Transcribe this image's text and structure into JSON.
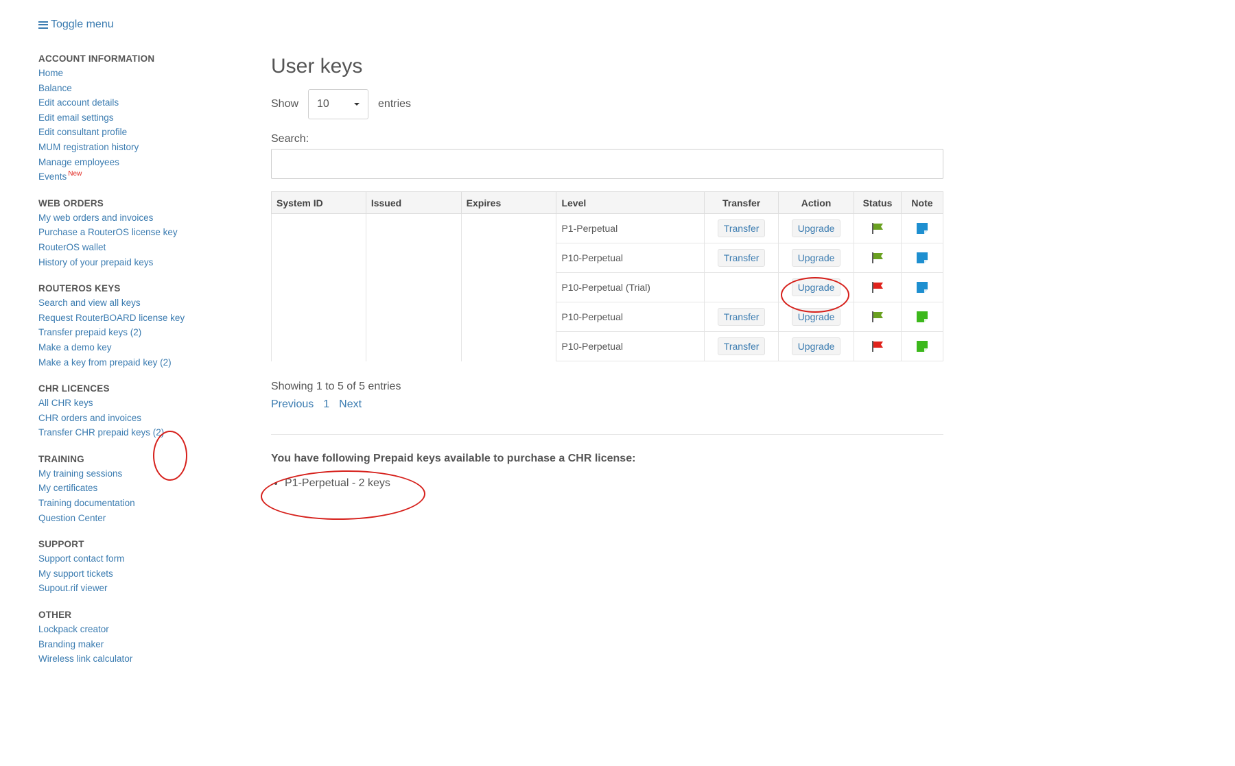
{
  "toggle_menu": "Toggle menu",
  "sidebar": {
    "sections": [
      {
        "title": "ACCOUNT INFORMATION",
        "items": [
          {
            "label": "Home"
          },
          {
            "label": "Balance"
          },
          {
            "label": "Edit account details"
          },
          {
            "label": "Edit email settings"
          },
          {
            "label": "Edit consultant profile"
          },
          {
            "label": "MUM registration history"
          },
          {
            "label": "Manage employees"
          },
          {
            "label": "Events",
            "badge": "New"
          }
        ]
      },
      {
        "title": "WEB ORDERS",
        "items": [
          {
            "label": "My web orders and invoices"
          },
          {
            "label": "Purchase a RouterOS license key"
          },
          {
            "label": "RouterOS wallet"
          },
          {
            "label": "History of your prepaid keys"
          }
        ]
      },
      {
        "title": "ROUTEROS KEYS",
        "items": [
          {
            "label": "Search and view all keys"
          },
          {
            "label": "Request RouterBOARD license key"
          },
          {
            "label": "Transfer prepaid keys (2)"
          },
          {
            "label": "Make a demo key"
          },
          {
            "label": "Make a key from prepaid key (2)"
          }
        ]
      },
      {
        "title": "CHR LICENCES",
        "items": [
          {
            "label": "All CHR keys"
          },
          {
            "label": "CHR orders and invoices"
          },
          {
            "label": "Transfer CHR prepaid keys (2)"
          }
        ]
      },
      {
        "title": "TRAINING",
        "items": [
          {
            "label": "My training sessions"
          },
          {
            "label": "My certificates"
          },
          {
            "label": "Training documentation"
          },
          {
            "label": "Question Center"
          }
        ]
      },
      {
        "title": "SUPPORT",
        "items": [
          {
            "label": "Support contact form"
          },
          {
            "label": "My support tickets"
          },
          {
            "label": "Supout.rif viewer"
          }
        ]
      },
      {
        "title": "OTHER",
        "items": [
          {
            "label": "Lockpack creator"
          },
          {
            "label": "Branding maker"
          },
          {
            "label": "Wireless link calculator"
          }
        ]
      }
    ]
  },
  "main": {
    "title": "User keys",
    "show_label": "Show",
    "entries_value": "10",
    "entries_label": "entries",
    "search_label": "Search:",
    "columns": [
      "System ID",
      "Issued",
      "Expires",
      "Level",
      "Transfer",
      "Action",
      "Status",
      "Note"
    ],
    "rows": [
      {
        "level": "P1-Perpetual",
        "transfer": "Transfer",
        "action": "Upgrade",
        "status": "ok",
        "note": "blue"
      },
      {
        "level": "P10-Perpetual",
        "transfer": "Transfer",
        "action": "Upgrade",
        "status": "ok",
        "note": "blue"
      },
      {
        "level": "P10-Perpetual (Trial)",
        "transfer": "",
        "action": "Upgrade",
        "status": "expired",
        "note": "blue"
      },
      {
        "level": "P10-Perpetual",
        "transfer": "Transfer",
        "action": "Upgrade",
        "status": "ok",
        "note": "green"
      },
      {
        "level": "P10-Perpetual",
        "transfer": "Transfer",
        "action": "Upgrade",
        "status": "expired",
        "note": "green"
      }
    ],
    "info": "Showing 1 to 5 of 5 entries",
    "pager": {
      "previous": "Previous",
      "page": "1",
      "next": "Next"
    },
    "prepaid_heading": "You have following Prepaid keys available to purchase a CHR license:",
    "prepaid_items": [
      "P1-Perpetual - 2 keys"
    ]
  },
  "colors": {
    "link": "#3a7bb0",
    "flag_ok": "#6aa121",
    "flag_expired": "#e0231c",
    "note_blue": "#1e8fd0",
    "note_green": "#3cb81c",
    "annotation": "#d6201b"
  }
}
